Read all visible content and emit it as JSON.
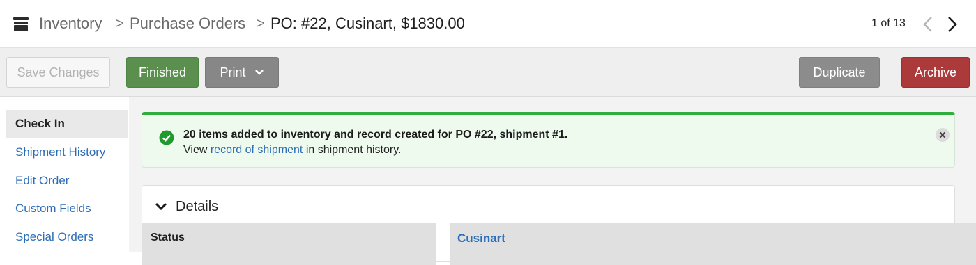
{
  "header": {
    "breadcrumb": [
      "Inventory",
      "Purchase Orders"
    ],
    "separator": ">",
    "current": "PO: #22, Cusinart, $1830.00",
    "pager": "1 of 13",
    "icons": {
      "section": "inventory-box-icon",
      "prev": "chevron-left-icon",
      "next": "chevron-right-icon"
    }
  },
  "toolbar": {
    "save_label": "Save Changes",
    "finished_label": "Finished",
    "print_label": "Print",
    "duplicate_label": "Duplicate",
    "archive_label": "Archive",
    "colors": {
      "finished": "#5a8f4e",
      "print": "#878787",
      "duplicate": "#8c8c8c",
      "archive": "#ad3a3a"
    }
  },
  "sidebar": {
    "items": [
      {
        "label": "Check In",
        "active": true
      },
      {
        "label": "Shipment History",
        "active": false
      },
      {
        "label": "Edit Order",
        "active": false
      },
      {
        "label": "Custom Fields",
        "active": false
      },
      {
        "label": "Special Orders",
        "active": false
      }
    ]
  },
  "alert": {
    "title": "20 items added to inventory and record created for PO #22, shipment #1.",
    "body_prefix": "View",
    "link": "record of shipment",
    "body_suffix": "in shipment history.",
    "accent": "#2fae3c"
  },
  "details": {
    "title": "Details",
    "status_label": "Status",
    "vendor": "Cusinart"
  }
}
